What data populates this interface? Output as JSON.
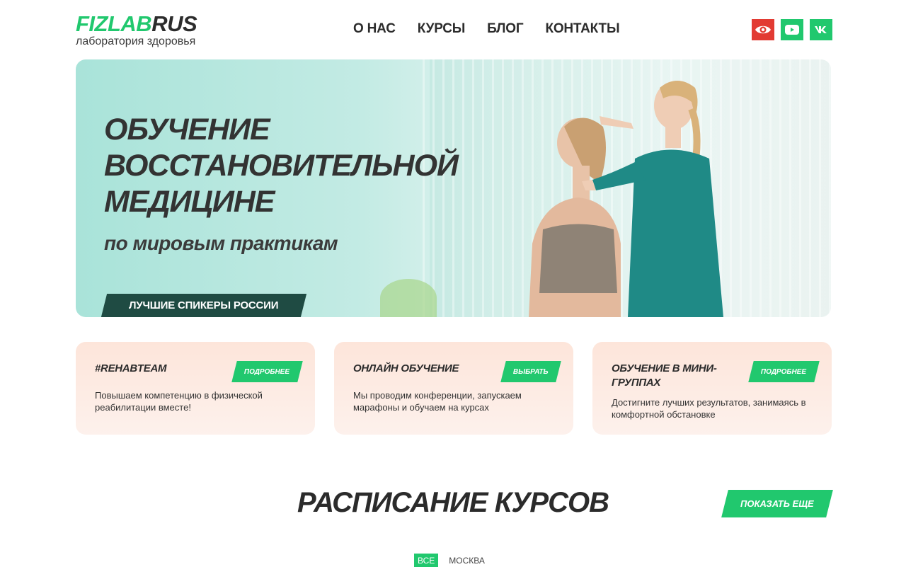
{
  "brand": {
    "name_green": "FIZLAB",
    "name_dark": "RUS",
    "tagline": "лаборатория здоровья",
    "accent": "#21c86e",
    "dark": "#1f4b43"
  },
  "nav": [
    "О НАС",
    "КУРСЫ",
    "БЛОГ",
    "КОНТАКТЫ"
  ],
  "socials": [
    {
      "icon": "eye-icon",
      "color": "#e23b33"
    },
    {
      "icon": "youtube-icon",
      "color": "#21c86e"
    },
    {
      "icon": "vk-icon",
      "color": "#21c86e"
    }
  ],
  "hero": {
    "title_line1": "ОБУЧЕНИЕ",
    "title_line2": "ВОССТАНОВИТЕЛЬНОЙ",
    "title_line3": "МЕДИЦИНЕ",
    "subtitle": "по мировым практикам",
    "badge": "ЛУЧШИЕ СПИКЕРЫ РОССИИ"
  },
  "cards": [
    {
      "title": "#REHABTEAM",
      "button": "ПОДРОБНЕЕ",
      "text_line1": "Повышаем компетенцию в физической",
      "text_line2": "реабилитации вместе!"
    },
    {
      "title": "ОНЛАЙН ОБУЧЕНИЕ",
      "button": "ВЫБРАТЬ",
      "text_line1": "Мы проводим конференции, запускаем",
      "text_line2": "марафоны и обучаем на курсах"
    },
    {
      "title_line1": "ОБУЧЕНИЕ В МИНИ-",
      "title_line2": "ГРУППАХ",
      "button": "ПОДРОБНЕЕ",
      "text_line1": "Достигните лучших результатов, занимаясь в",
      "text_line2": "комфортной обстановке"
    }
  ],
  "schedule": {
    "title": "РАСПИСАНИЕ КУРСОВ",
    "show_more": "ПОКАЗАТЬ ЕЩЕ",
    "filters": [
      "ВСЕ",
      "МОСКВА"
    ]
  }
}
